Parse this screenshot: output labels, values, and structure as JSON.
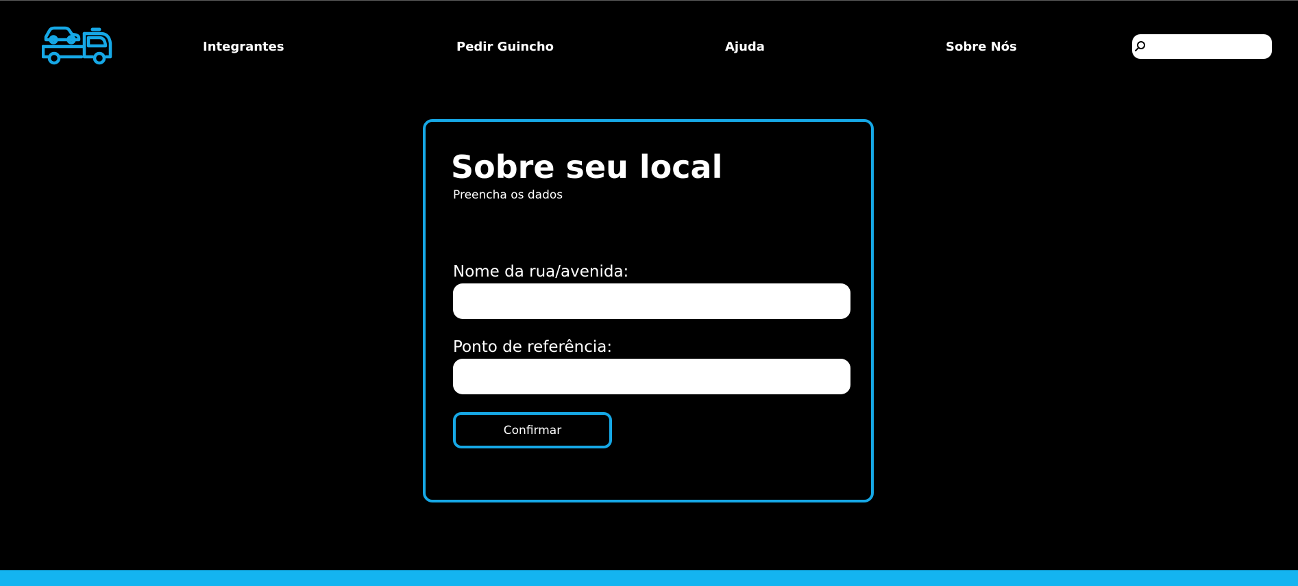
{
  "theme": {
    "accent": "#16a8e6",
    "background": "#000000",
    "text": "#ffffff",
    "footer": "#14b4f0"
  },
  "header": {
    "logo_icon": "tow-truck-icon",
    "nav": [
      {
        "label": "Integrantes"
      },
      {
        "label": "Pedir Guincho"
      },
      {
        "label": "Ajuda"
      },
      {
        "label": "Sobre Nós"
      }
    ],
    "search": {
      "icon": "search-icon",
      "value": "",
      "placeholder": ""
    }
  },
  "form": {
    "title": "Sobre seu local",
    "subtitle": "Preencha os dados",
    "fields": [
      {
        "label": "Nome da rua/avenida:",
        "value": ""
      },
      {
        "label": "Ponto de referência:",
        "value": ""
      }
    ],
    "submit_label": "Confirmar"
  }
}
